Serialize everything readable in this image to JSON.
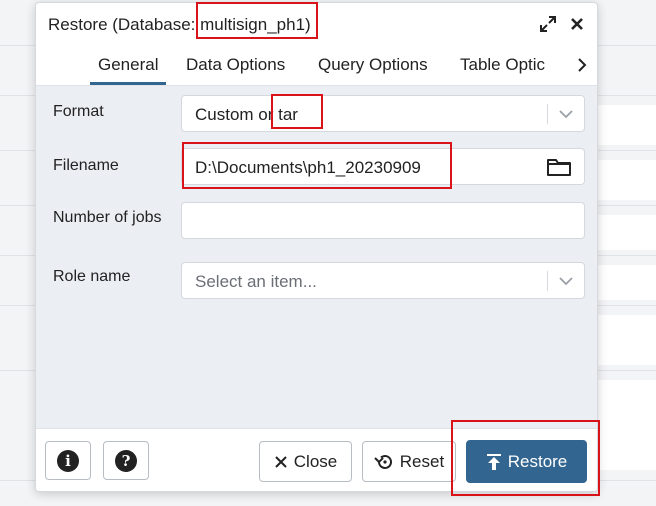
{
  "dialog": {
    "title": "Restore (Database: multisign_ph1)"
  },
  "tabs": [
    "General",
    "Data Options",
    "Query Options",
    "Table Optic"
  ],
  "form": {
    "format_label": "Format",
    "format_value": "Custom or tar",
    "filename_label": "Filename",
    "filename_value": "D:\\Documents\\ph1_20230909",
    "jobs_label": "Number of jobs",
    "jobs_value": "",
    "role_label": "Role name",
    "role_placeholder": "Select an item..."
  },
  "footer": {
    "close_label": "Close",
    "reset_label": "Reset",
    "restore_label": "Restore"
  },
  "colors": {
    "primary": "#326690",
    "annotation": "#d9131a",
    "body_bg": "#ebeef3"
  }
}
